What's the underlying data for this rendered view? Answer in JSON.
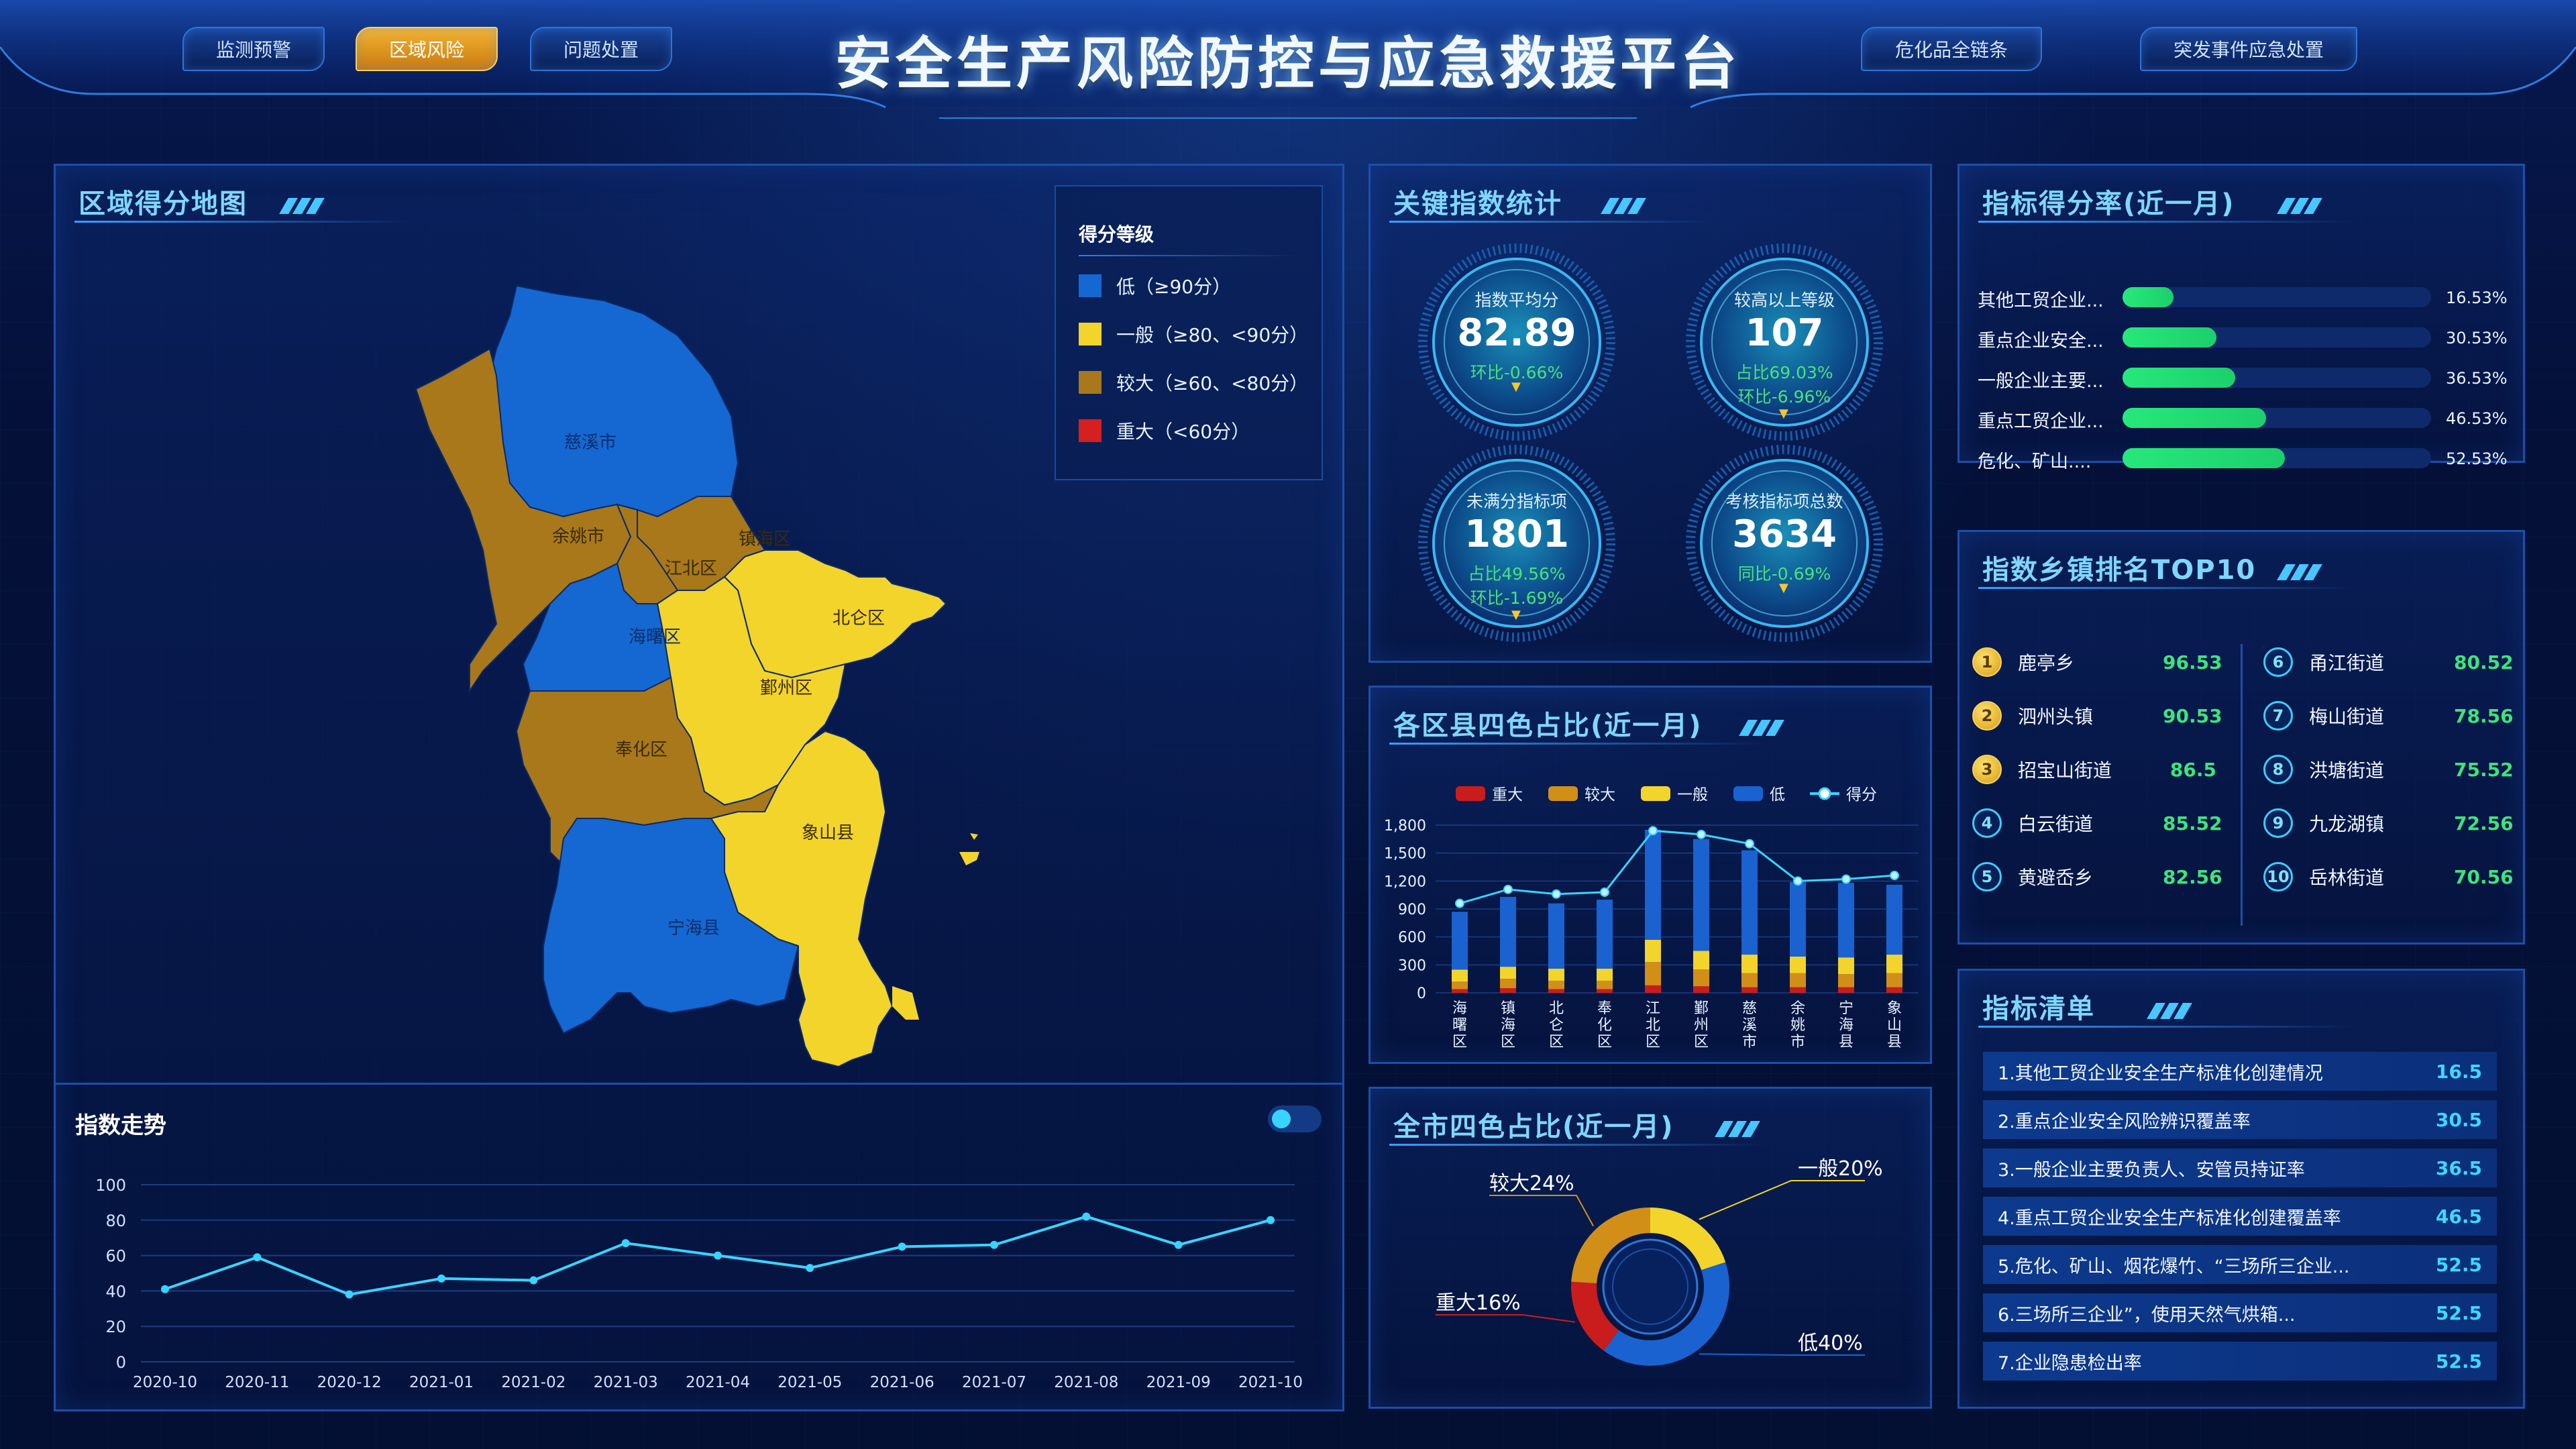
{
  "header": {
    "title": "安全生产风险防控与应急救援平台",
    "nav_left": [
      "监测预警",
      "区域风险",
      "问题处置"
    ],
    "nav_right": [
      "危化品全链条",
      "突发事件应急处置"
    ],
    "active_nav": "区域风险"
  },
  "map_panel": {
    "title": "区域得分地图",
    "legend_title": "得分等级",
    "legend": [
      {
        "label": "低（≥90分）",
        "color": "#1568d1"
      },
      {
        "label": "一般（≥80、<90分）",
        "color": "#f2d42b"
      },
      {
        "label": "较大（≥60、<80分）",
        "color": "#a8781a"
      },
      {
        "label": "重大（<60分）",
        "color": "#d61f1f"
      }
    ],
    "regions": {
      "cixi": "慈溪市",
      "yuyao": "余姚市",
      "zhenhai": "镇海区",
      "jiangbei": "江北区",
      "haishu": "海曙区",
      "beilun": "北仑区",
      "yinzhou": "鄞州区",
      "fenghua": "奉化区",
      "xiangshan": "象山县",
      "ninghai": "宁海县"
    }
  },
  "trend_panel": {
    "title": "指数走势",
    "chart_data": {
      "type": "line",
      "x": [
        "2020-10",
        "2020-11",
        "2020-12",
        "2021-01",
        "2021-02",
        "2021-03",
        "2021-04",
        "2021-05",
        "2021-06",
        "2021-07",
        "2021-08",
        "2021-09",
        "2021-10"
      ],
      "values": [
        41,
        59,
        38,
        47,
        46,
        67,
        60,
        53,
        65,
        66,
        82,
        66,
        80
      ],
      "ylim": [
        0,
        100
      ],
      "yticks": [
        0,
        20,
        40,
        60,
        80,
        100
      ],
      "grid": true
    }
  },
  "key_index": {
    "title": "关键指数统计",
    "items": [
      {
        "label": "指数平均分",
        "value": "82.89",
        "sub1": "环比-0.66%",
        "sub2": ""
      },
      {
        "label": "较高以上等级",
        "value": "107",
        "sub1": "占比69.03%",
        "sub2": "环比-6.96%"
      },
      {
        "label": "未满分指标项",
        "value": "1801",
        "sub1": "占比49.56%",
        "sub2": "环比-1.69%"
      },
      {
        "label": "考核指标项总数",
        "value": "3634",
        "sub1": "同比-0.69%",
        "sub2": ""
      }
    ]
  },
  "district_chart": {
    "title": "各区县四色占比(近一月)",
    "chart_data": {
      "type": "bar",
      "stacked": true,
      "categories": [
        "海曙区",
        "镇海区",
        "北仑区",
        "奉化区",
        "江北区",
        "鄞州区",
        "慈溪市",
        "余姚市",
        "宁海县",
        "象山县"
      ],
      "series": [
        {
          "name": "重大",
          "color": "#c91d1d",
          "values": [
            40,
            50,
            40,
            40,
            80,
            70,
            60,
            60,
            60,
            60
          ]
        },
        {
          "name": "较大",
          "color": "#d18f18",
          "values": [
            80,
            100,
            90,
            90,
            250,
            180,
            150,
            150,
            140,
            150
          ]
        },
        {
          "name": "一般",
          "color": "#f2d42b",
          "values": [
            130,
            130,
            130,
            130,
            240,
            200,
            200,
            180,
            180,
            200
          ]
        },
        {
          "name": "低",
          "color": "#1a62cf",
          "values": [
            620,
            750,
            700,
            740,
            1180,
            1200,
            1120,
            800,
            800,
            750
          ]
        }
      ],
      "line": {
        "name": "得分",
        "values": [
          960,
          1110,
          1060,
          1080,
          1740,
          1700,
          1600,
          1200,
          1220,
          1260
        ]
      },
      "ylim": [
        0,
        1800
      ],
      "yticks": [
        "0",
        "300",
        "600",
        "900",
        "1,200",
        "1,500",
        "1,800"
      ]
    }
  },
  "city_chart": {
    "title": "全市四色占比(近一月)",
    "chart_data": {
      "type": "pie",
      "donut": true,
      "slices": [
        {
          "name": "一般",
          "value": 20,
          "label": "一般20%",
          "color": "#f2d42b"
        },
        {
          "name": "低",
          "value": 40,
          "label": "低40%",
          "color": "#1a62cf"
        },
        {
          "name": "重大",
          "value": 16,
          "label": "重大16%",
          "color": "#c91d1d"
        },
        {
          "name": "较大",
          "value": 24,
          "label": "较大24%",
          "color": "#d18f18"
        }
      ]
    }
  },
  "score_rate": {
    "title": "指标得分率(近一月)",
    "chart_data": {
      "type": "bar",
      "orientation": "horizontal",
      "categories": [
        "其他工贸企业...",
        "重点企业安全...",
        "一般企业主要...",
        "重点工贸企业...",
        "危化、矿山...."
      ],
      "values": [
        16.53,
        30.53,
        36.53,
        46.53,
        52.53
      ],
      "labels": [
        "16.53%",
        "30.53%",
        "36.53%",
        "46.53%",
        "52.53%"
      ],
      "xlim": [
        0,
        100
      ]
    }
  },
  "ranking": {
    "title": "指数乡镇排名TOP10",
    "items": [
      {
        "rank": "1",
        "name": "鹿亭乡",
        "score": "96.53"
      },
      {
        "rank": "2",
        "name": "泗州头镇",
        "score": "90.53"
      },
      {
        "rank": "3",
        "name": "招宝山街道",
        "score": "86.5"
      },
      {
        "rank": "4",
        "name": "白云街道",
        "score": "85.52"
      },
      {
        "rank": "5",
        "name": "黄避岙乡",
        "score": "82.56"
      },
      {
        "rank": "6",
        "name": "甬江街道",
        "score": "80.52"
      },
      {
        "rank": "7",
        "name": "梅山街道",
        "score": "78.56"
      },
      {
        "rank": "8",
        "name": "洪塘街道",
        "score": "75.52"
      },
      {
        "rank": "9",
        "name": "九龙湖镇",
        "score": "72.56"
      },
      {
        "rank": "10",
        "name": "岳林街道",
        "score": "70.56"
      }
    ]
  },
  "index_list": {
    "title": "指标清单",
    "items": [
      {
        "text": "1.其他工贸企业安全生产标准化创建情况",
        "value": "16.5"
      },
      {
        "text": "2.重点企业安全风险辨识覆盖率",
        "value": "30.5"
      },
      {
        "text": "3.一般企业主要负责人、安管员持证率",
        "value": "36.5"
      },
      {
        "text": "4.重点工贸企业安全生产标准化创建覆盖率",
        "value": "46.5"
      },
      {
        "text": "5.危化、矿山、烟花爆竹、“三场所三企业...",
        "value": "52.5"
      },
      {
        "text": "6.三场所三企业”，使用天然气烘箱...",
        "value": "52.5"
      },
      {
        "text": "7.企业隐患检出率",
        "value": "52.5"
      }
    ]
  }
}
